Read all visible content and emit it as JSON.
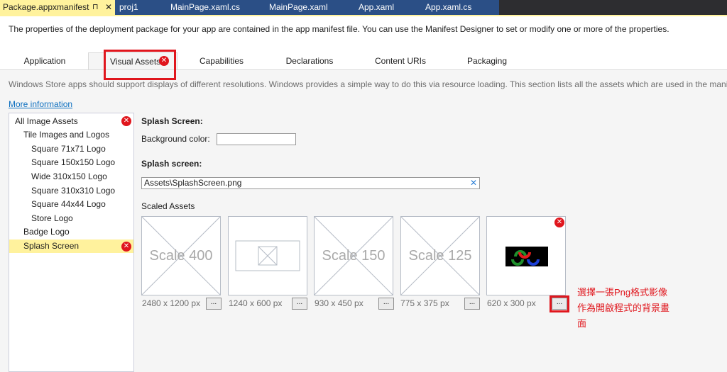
{
  "document_tabs": [
    {
      "label": "Package.appxmanifest",
      "pin": "⊓",
      "close": "✕"
    },
    {
      "label": "proj1"
    },
    {
      "label": "MainPage.xaml.cs"
    },
    {
      "label": "MainPage.xaml"
    },
    {
      "label": "App.xaml"
    },
    {
      "label": "App.xaml.cs"
    }
  ],
  "description": "The properties of the deployment package for your app are contained in the app manifest file. You can use the Manifest Designer to set or modify one or more of the properties.",
  "designer_tabs": [
    "Application",
    "Visual Assets",
    "Capabilities",
    "Declarations",
    "Content URIs",
    "Packaging"
  ],
  "intro": "Windows Store apps should support displays of different resolutions. Windows provides a simple way to do this via resource loading. This section lists all the assets which are used in the manifest.",
  "more_info": "More information",
  "tree": [
    "All Image Assets",
    "Tile Images and Logos",
    "Square 71x71 Logo",
    "Square 150x150 Logo",
    "Wide 310x150 Logo",
    "Square 310x310 Logo",
    "Square 44x44 Logo",
    "Store Logo",
    "Badge Logo",
    "Splash Screen"
  ],
  "splash": {
    "heading": "Splash Screen:",
    "bg_color_label": "Background color:",
    "bg_color_value": "",
    "splash_label": "Splash screen:",
    "splash_value": "Assets\\SplashScreen.png",
    "clear_icon": "✕",
    "scaled_assets_label": "Scaled Assets"
  },
  "assets": [
    {
      "name": "Scale 400",
      "size": "2480 x 1200 px"
    },
    {
      "name": "",
      "size": "1240 x 600 px"
    },
    {
      "name": "Scale 150",
      "size": "930 x 450 px"
    },
    {
      "name": "Scale 125",
      "size": "775 x 375 px"
    },
    {
      "name": "",
      "size": "620 x 300 px"
    }
  ],
  "browse_label": "...",
  "error_glyph": "✕",
  "annotation": "選擇一張Png格式影像作為開啟程式的背景畫面",
  "colors": {
    "accent": "#fff29d",
    "tab_strip": "#2b4f86",
    "error": "#e0161d",
    "link": "#0e70c0"
  }
}
